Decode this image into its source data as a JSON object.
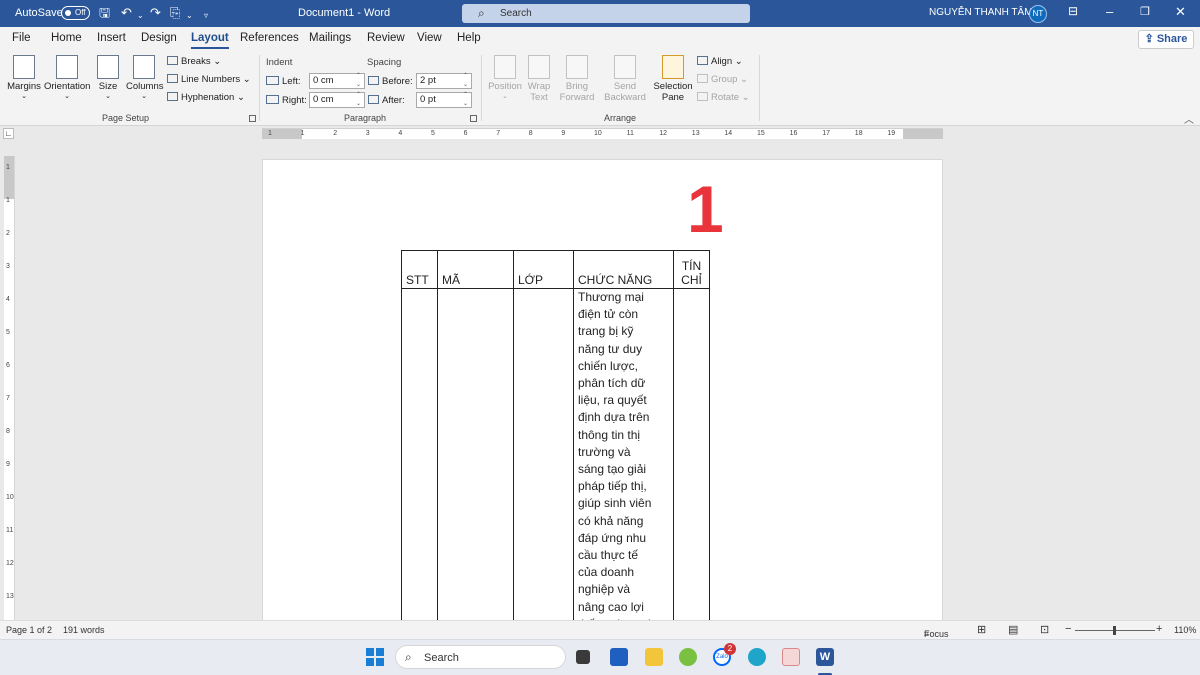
{
  "titlebar": {
    "autosave_label": "AutoSave",
    "autosave_state": "Off",
    "document_title": "Document1  -  Word",
    "search_placeholder": "Search",
    "user_name": "NGUYỄN THANH TÂM",
    "user_initials": "NT"
  },
  "tabs": [
    "File",
    "Home",
    "Insert",
    "Design",
    "Layout",
    "References",
    "Mailings",
    "Review",
    "View",
    "Help"
  ],
  "share_label": "Share",
  "ribbon": {
    "page_setup": {
      "margins": "Margins",
      "orientation": "Orientation",
      "size": "Size",
      "columns": "Columns",
      "breaks": "Breaks",
      "line_numbers": "Line Numbers",
      "hyphenation": "Hyphenation",
      "group_label": "Page Setup"
    },
    "paragraph": {
      "indent_header": "Indent",
      "spacing_header": "Spacing",
      "left_label": "Left:",
      "left_value": "0 cm",
      "right_label": "Right:",
      "right_value": "0 cm",
      "before_label": "Before:",
      "before_value": "2 pt",
      "after_label": "After:",
      "after_value": "0 pt",
      "group_label": "Paragraph"
    },
    "arrange": {
      "position": "Position",
      "wrap_text_1": "Wrap",
      "wrap_text_2": "Text",
      "bring_forward_1": "Bring",
      "bring_forward_2": "Forward",
      "send_backward_1": "Send",
      "send_backward_2": "Backward",
      "selection_pane_1": "Selection",
      "selection_pane_2": "Pane",
      "align": "Align",
      "group": "Group",
      "rotate": "Rotate",
      "group_label": "Arrange"
    }
  },
  "ruler": {
    "horizontal": [
      "1",
      "1",
      "2",
      "3",
      "4",
      "5",
      "6",
      "7",
      "8",
      "9",
      "10",
      "11",
      "12",
      "13",
      "14",
      "15",
      "16",
      "17",
      "18",
      "19"
    ],
    "vertical": [
      "1",
      "1",
      "2",
      "3",
      "4",
      "5",
      "6",
      "7",
      "8",
      "9",
      "10",
      "11",
      "12",
      "13"
    ]
  },
  "document": {
    "page_number_marker": "1",
    "table_headers": [
      "STT",
      "MÃ",
      "LỚP",
      "CHỨC NĂNG",
      "TÍN\nCHỈ"
    ],
    "function_text": "Thương mại\nđiện tử còn\ntrang bị kỹ\nnăng tư duy\nchiến lược,\nphân tích dữ\nliệu, ra quyết\nđịnh dựa trên\nthông tin thị\ntrường và\nsáng tạo giải\npháp tiếp thị,\ngiúp sinh viên\ncó khả năng\nđáp ứng nhu\ncầu thực tế\ncủa doanh\nnghiệp và\nnâng cao lợi\nthế cạnh tranh"
  },
  "status": {
    "page": "Page 1 of 2",
    "words": "191 words",
    "focus": "Focus",
    "zoom": "110%"
  },
  "taskbar": {
    "search_placeholder": "Search",
    "badge_count": "2",
    "zalo_label": "Zalo"
  },
  "colors": {
    "word_blue": "#2b579a",
    "marker_red": "#e8343a"
  }
}
